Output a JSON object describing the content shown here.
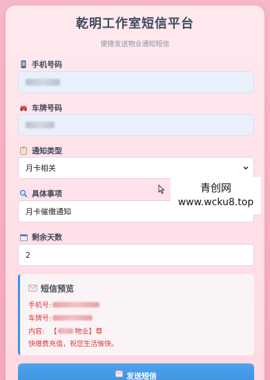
{
  "header": {
    "title": "乾明工作室短信平台",
    "subtitle": "便捷发送物业通知短信"
  },
  "form": {
    "phone": {
      "label": "手机号码",
      "icon": "phone-icon"
    },
    "plate": {
      "label": "车牌号码",
      "icon": "car-icon"
    },
    "notify_type": {
      "label": "通知类型",
      "icon": "clipboard-icon",
      "value": "月卡相关"
    },
    "item": {
      "label": "具体事项",
      "icon": "magnifier-icon",
      "value": "月卡催缴通知"
    },
    "days": {
      "label": "剩余天数",
      "icon": "calendar-icon",
      "value": "2"
    }
  },
  "preview": {
    "title": "短信预览",
    "phone_label": "手机号:",
    "plate_label": "车牌号:",
    "content_label": "内容:",
    "content_bracket_open": "【",
    "content_suffix": "物业】尊",
    "content_line2": "快缴费充值，祝您生活愉快。"
  },
  "send_button": {
    "label": "发送短信",
    "icon": "send-icon"
  },
  "watermark": {
    "line1": "青创网",
    "line2": "www.wcku8.top"
  },
  "colors": {
    "accent": "#3b8fdd",
    "preview_text": "#d63a3a",
    "background": "#f7b7c6"
  }
}
